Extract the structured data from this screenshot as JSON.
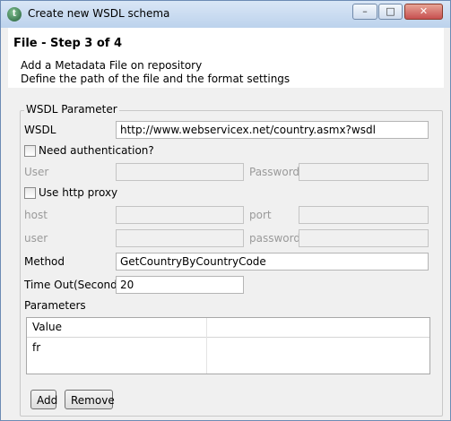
{
  "window": {
    "title": "Create new WSDL schema",
    "minimize_glyph": "–",
    "maximize_glyph": "□",
    "close_glyph": "✕"
  },
  "header": {
    "step": "File - Step 3 of 4",
    "description_1": "Add a Metadata File on repository",
    "description_2": "Define the path of the file and the format settings"
  },
  "wsdl_parameter": {
    "group_label": "WSDL Parameter",
    "wsdl_label": "WSDL",
    "wsdl_value": "http://www.webservicex.net/country.asmx?wsdl",
    "need_auth_label": "Need authentication?",
    "need_auth_checked": false,
    "auth_user_label": "User",
    "auth_user_value": "",
    "auth_password_label": "Password",
    "auth_password_value": "",
    "use_proxy_label": "Use http proxy",
    "use_proxy_checked": false,
    "proxy_host_label": "host",
    "proxy_host_value": "",
    "proxy_port_label": "port",
    "proxy_port_value": "",
    "proxy_user_label": "user",
    "proxy_user_value": "",
    "proxy_password_label": "password",
    "proxy_password_value": "",
    "method_label": "Method",
    "method_value": "GetCountryByCountryCode",
    "timeout_label": "Time Out(Second)",
    "timeout_value": "20",
    "parameters_label": "Parameters",
    "parameters_table": {
      "columns": [
        "Value",
        ""
      ],
      "rows": [
        [
          "fr",
          ""
        ]
      ]
    },
    "add_button": "Add",
    "remove_button": "Remove"
  }
}
